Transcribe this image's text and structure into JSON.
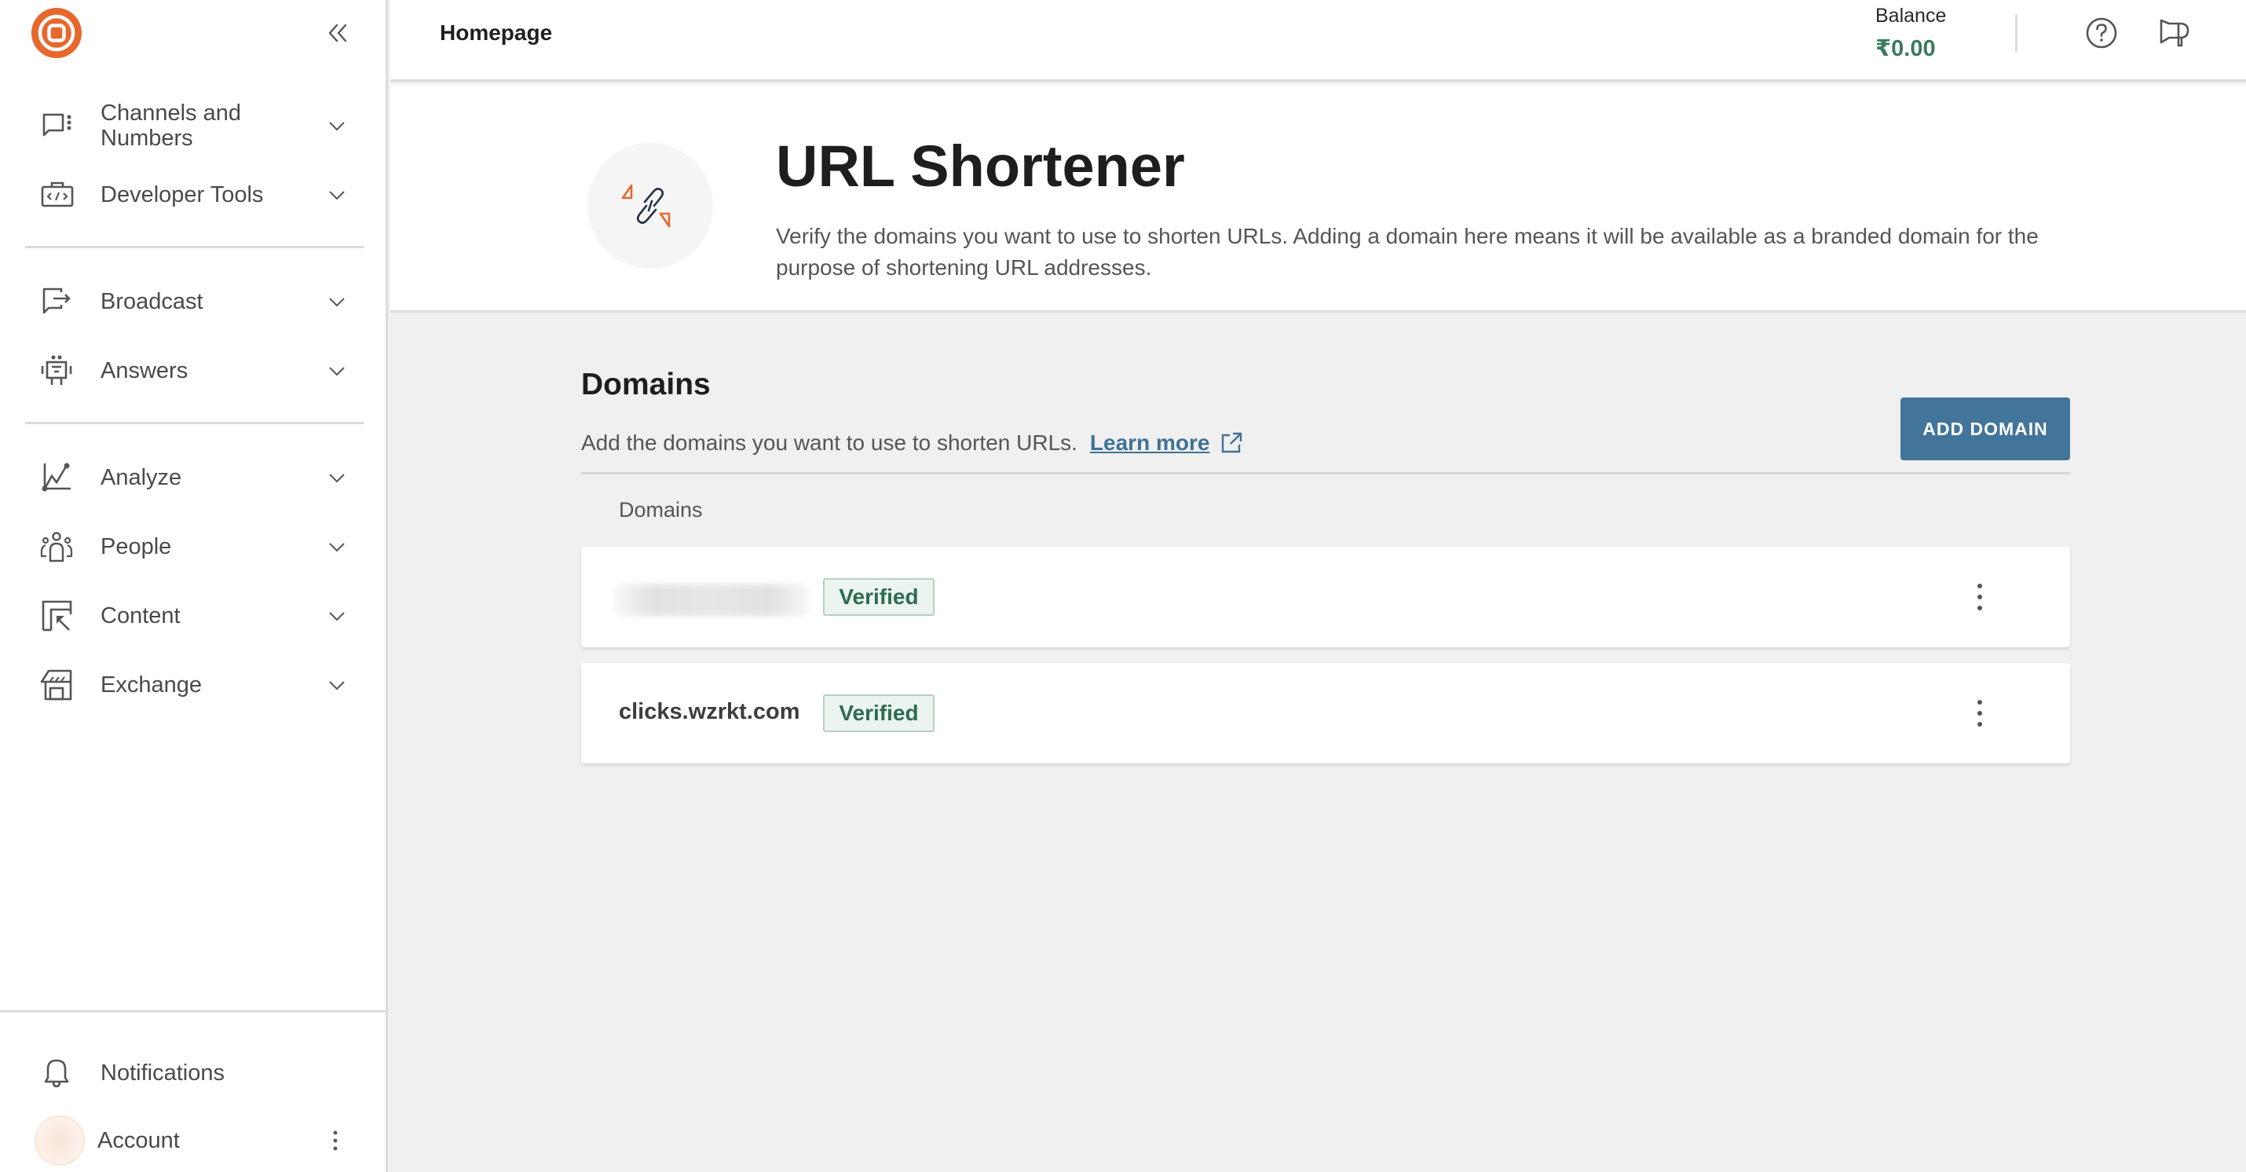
{
  "sidebar": {
    "logo": "brand-logo",
    "collapse_icon": "double-chevron-left-icon",
    "groups": [
      {
        "items": [
          {
            "label_line1": "Channels and",
            "label_line2": "Numbers",
            "icon": "chat-options-icon"
          },
          {
            "label": "Developer Tools",
            "icon": "code-briefcase-icon"
          }
        ]
      },
      {
        "items": [
          {
            "label": "Broadcast",
            "icon": "broadcast-icon"
          },
          {
            "label": "Answers",
            "icon": "bot-icon"
          }
        ]
      },
      {
        "items": [
          {
            "label": "Analyze",
            "icon": "line-chart-icon"
          },
          {
            "label": "People",
            "icon": "people-icon"
          },
          {
            "label": "Content",
            "icon": "content-icon"
          },
          {
            "label": "Exchange",
            "icon": "storefront-icon"
          }
        ]
      }
    ],
    "bottom": {
      "notifications": "Notifications",
      "account": "Account"
    }
  },
  "header": {
    "title": "Homepage",
    "balance_label": "Balance",
    "balance_value": "₹0.00",
    "help_icon": "help-circle-icon",
    "announce_icon": "megaphone-icon"
  },
  "hero": {
    "icon": "link-shorten-icon",
    "title": "URL Shortener",
    "description": "Verify the domains you want to use to shorten URLs. Adding a domain here means it will be available as a branded domain for the purpose of shortening URL addresses."
  },
  "domains": {
    "title": "Domains",
    "subtitle": "Add the domains you want to use to shorten URLs.",
    "learn_more": "Learn more",
    "add_button": "ADD DOMAIN",
    "column_header": "Domains",
    "rows": [
      {
        "name": "",
        "redacted": true,
        "status": "Verified"
      },
      {
        "name": "clicks.wzrkt.com",
        "redacted": false,
        "status": "Verified"
      }
    ]
  },
  "colors": {
    "brand_orange": "#e8672c",
    "primary_button": "#43759a",
    "link": "#3f7296",
    "verified_text": "#2f6b51",
    "verified_bg": "#ebf4ef",
    "balance": "#3a7a5e"
  }
}
